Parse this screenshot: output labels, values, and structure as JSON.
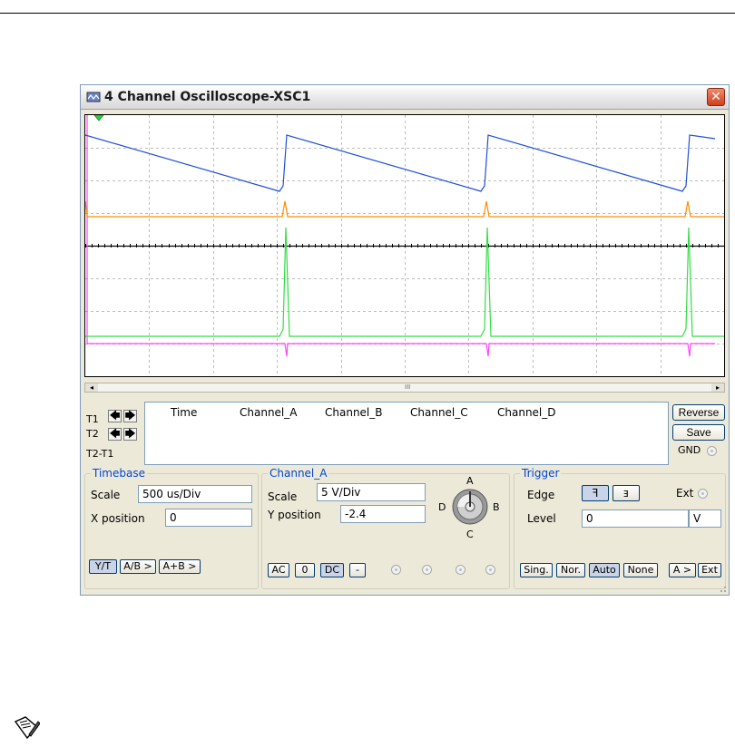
{
  "window": {
    "title": "4 Channel Oscilloscope-XSC1",
    "close_glyph": "✕"
  },
  "icons": {
    "app_icon": "oscilloscope-icon",
    "note_icon": "note-pencil-icon",
    "knob": "channel-selector-knob-icon"
  },
  "display": {
    "background": "#ffffff",
    "grid_color": "#bdbdbd",
    "axis_color": "#000000",
    "trigger_marker_color": "#2ecc40",
    "channel_colors": {
      "A": "#1f4fd8",
      "B": "#ff8c00",
      "C": "#33dd44",
      "D": "#ff44ff"
    }
  },
  "scrollbar": {
    "left_arrow": "◂",
    "right_arrow": "▸",
    "grip": "III"
  },
  "cursors": {
    "t1_label": "T1",
    "t2_label": "T2",
    "diff_label": "T2-T1",
    "left_glyph": "🡄",
    "right_glyph": "🡆"
  },
  "readout": {
    "columns": [
      "Time",
      "Channel_A",
      "Channel_B",
      "Channel_C",
      "Channel_D"
    ]
  },
  "side_buttons": {
    "reverse": "Reverse",
    "save": "Save",
    "gnd": "GND"
  },
  "timebase": {
    "title": "Timebase",
    "scale_label": "Scale",
    "scale_value": "500 us/Div",
    "xpos_label": "X position",
    "xpos_value": "0",
    "buttons": [
      "Y/T",
      "A/B >",
      "A+B >"
    ]
  },
  "channel": {
    "title": "Channel_A",
    "scale_label": "Scale",
    "scale_value": "5  V/Div",
    "ypos_label": "Y position",
    "ypos_value": "-2.4",
    "buttons": [
      "AC",
      "0",
      "DC",
      "-"
    ],
    "knob_labels": {
      "a": "A",
      "b": "B",
      "c": "C",
      "d": "D"
    }
  },
  "trigger": {
    "title": "Trigger",
    "edge_label": "Edge",
    "rising_glyph": "ꟻ",
    "falling_glyph": "ⱻ",
    "ext_label": "Ext",
    "level_label": "Level",
    "level_value": "0",
    "level_unit": "V",
    "mode_buttons": [
      "Sing.",
      "Nor.",
      "Auto",
      "None"
    ],
    "source_buttons": [
      "A >",
      "Ext"
    ]
  }
}
